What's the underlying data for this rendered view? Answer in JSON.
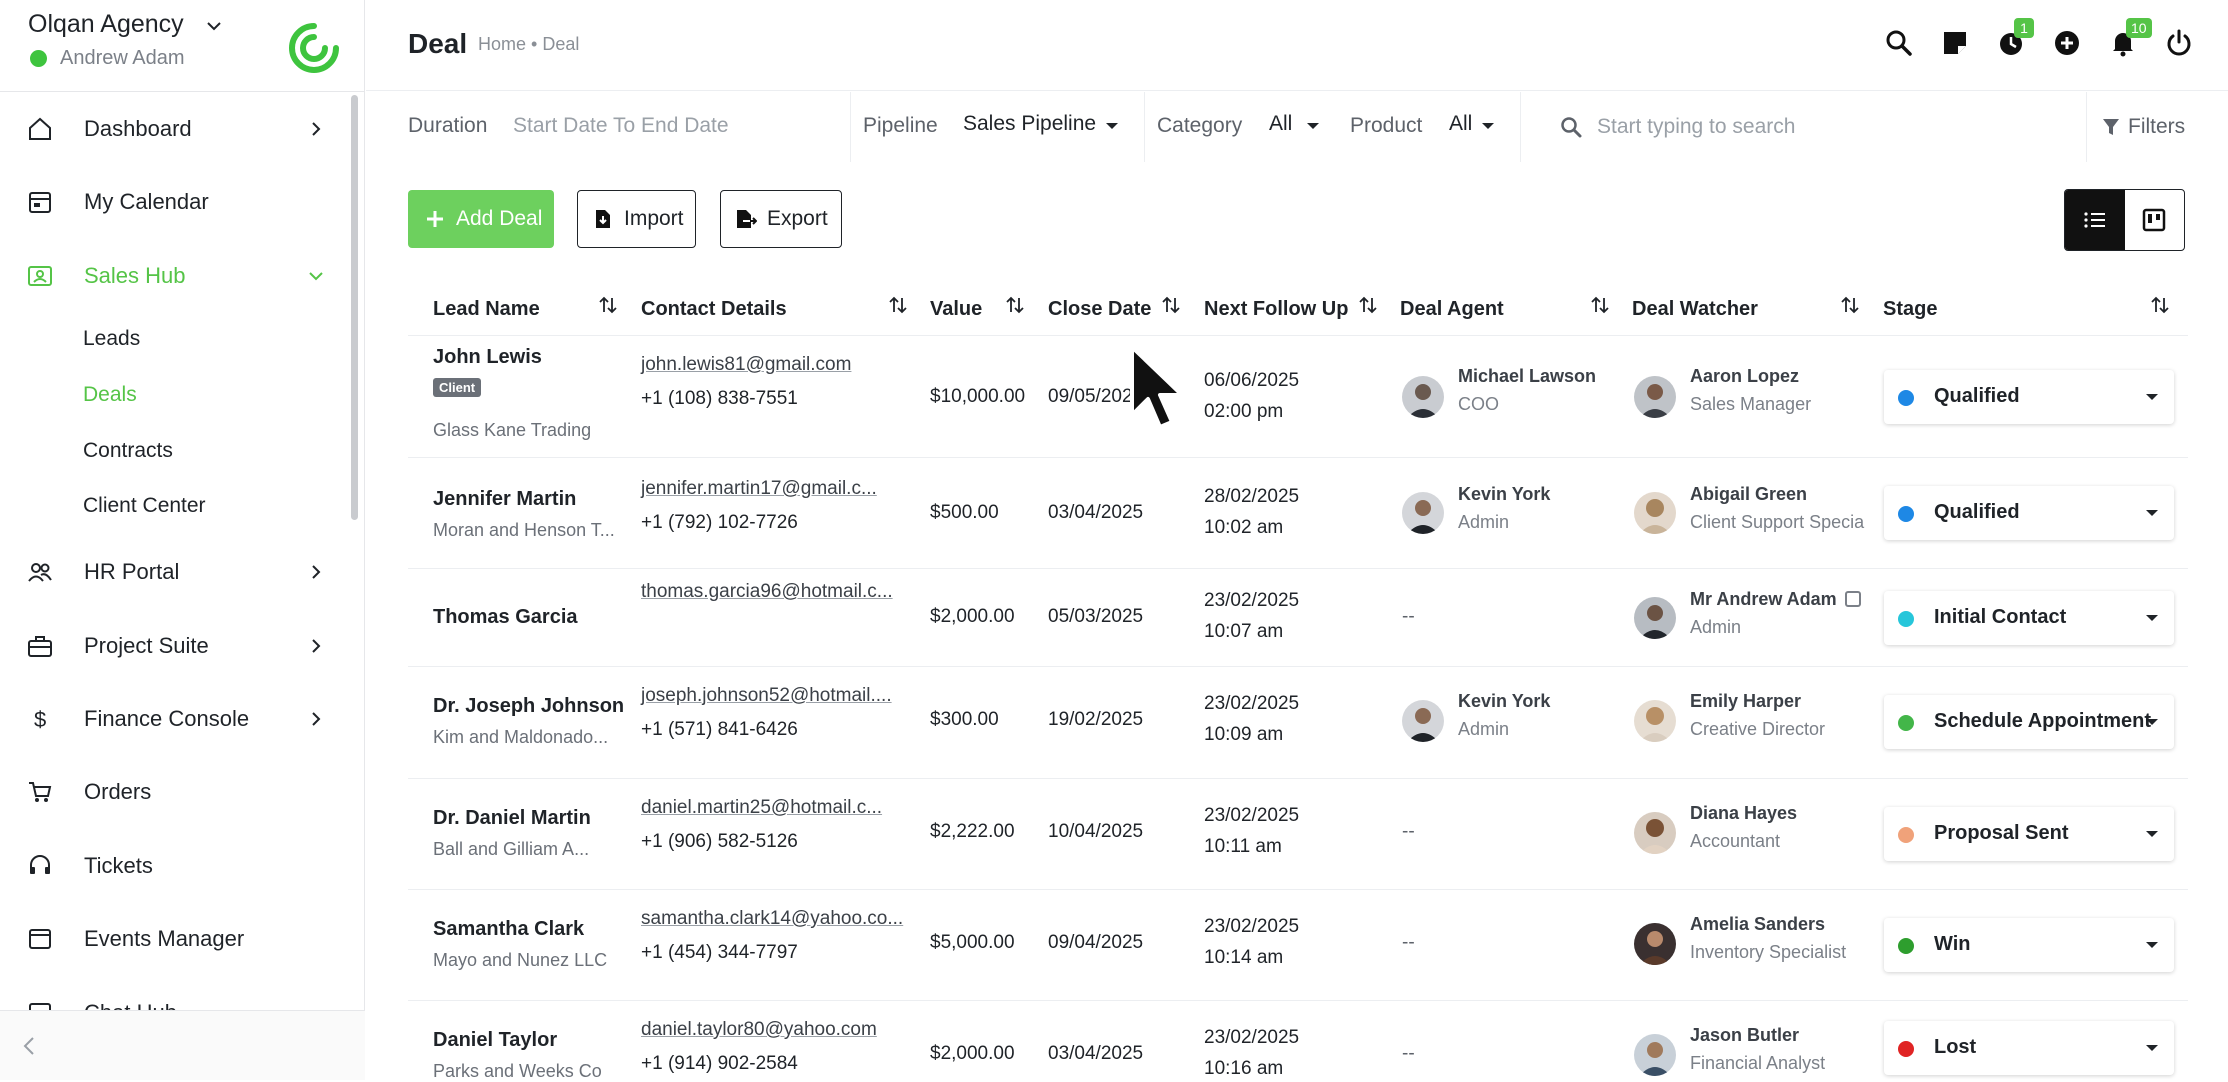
{
  "brand": {
    "name": "Olqan Agency",
    "user": "Andrew Adam"
  },
  "nav": {
    "items": [
      {
        "key": "dashboard",
        "label": "Dashboard"
      },
      {
        "key": "calendar",
        "label": "My Calendar"
      },
      {
        "key": "sales",
        "label": "Sales Hub"
      },
      {
        "key": "hr",
        "label": "HR Portal"
      },
      {
        "key": "project",
        "label": "Project Suite"
      },
      {
        "key": "finance",
        "label": "Finance Console"
      },
      {
        "key": "orders",
        "label": "Orders"
      },
      {
        "key": "tickets",
        "label": "Tickets"
      },
      {
        "key": "events",
        "label": "Events Manager"
      },
      {
        "key": "chat",
        "label": "Chat Hub"
      }
    ],
    "sub": [
      "Leads",
      "Deals",
      "Contracts",
      "Client Center"
    ]
  },
  "header": {
    "title": "Deal",
    "breadcrumb": "Home • Deal",
    "badges": {
      "timer": "1",
      "notifications": "10"
    }
  },
  "filters": {
    "duration_label": "Duration",
    "duration_value": "Start Date To End Date",
    "pipeline_label": "Pipeline",
    "pipeline_value": "Sales Pipeline",
    "category_label": "Category",
    "category_value": "All",
    "product_label": "Product",
    "product_value": "All",
    "search_placeholder": "Start typing to search",
    "filters_label": "Filters"
  },
  "actions": {
    "add": "Add Deal",
    "import": "Import",
    "export": "Export"
  },
  "table": {
    "columns": [
      "Lead Name",
      "Contact Details",
      "Value",
      "Close Date",
      "Next Follow Up",
      "Deal Agent",
      "Deal Watcher",
      "Stage"
    ],
    "rows": [
      {
        "name": "John Lewis",
        "tag": "Client",
        "company": "Glass Kane Trading",
        "email": "john.lewis81@gmail.com",
        "phone": "+1 (108) 838-7551",
        "value": "$10,000.00",
        "close": "09/05/2025",
        "follow_date": "06/06/2025",
        "follow_time": "02:00 pm",
        "agent_name": "Michael Lawson",
        "agent_role": "COO",
        "watcher_name": "Aaron Lopez",
        "watcher_role": "Sales Manager",
        "stage": "Qualified",
        "stage_color": "#1e88e5"
      },
      {
        "name": "Jennifer Martin",
        "tag": "",
        "company": "Moran and Henson T...",
        "email": "jennifer.martin17@gmail.c...",
        "phone": "+1 (792) 102-7726",
        "value": "$500.00",
        "close": "03/04/2025",
        "follow_date": "28/02/2025",
        "follow_time": "10:02 am",
        "agent_name": "Kevin York",
        "agent_role": "Admin",
        "watcher_name": "Abigail Green",
        "watcher_role": "Client Support Specia",
        "stage": "Qualified",
        "stage_color": "#1e88e5"
      },
      {
        "name": "Thomas Garcia",
        "tag": "",
        "company": "",
        "email": "thomas.garcia96@hotmail.c...",
        "phone": "",
        "value": "$2,000.00",
        "close": "05/03/2025",
        "follow_date": "23/02/2025",
        "follow_time": "10:07 am",
        "agent_name": "--",
        "agent_role": "",
        "watcher_name": "Mr Andrew Adam",
        "watcher_role": "Admin",
        "stage": "Initial Contact",
        "stage_color": "#26c6da"
      },
      {
        "name": "Dr. Joseph Johnson",
        "tag": "",
        "company": "Kim and Maldonado...",
        "email": "joseph.johnson52@hotmail....",
        "phone": "+1 (571) 841-6426",
        "value": "$300.00",
        "close": "19/02/2025",
        "follow_date": "23/02/2025",
        "follow_time": "10:09 am",
        "agent_name": "Kevin York",
        "agent_role": "Admin",
        "watcher_name": "Emily Harper",
        "watcher_role": "Creative Director",
        "stage": "Schedule Appointment",
        "stage_color": "#43b649"
      },
      {
        "name": "Dr. Daniel Martin",
        "tag": "",
        "company": "Ball and Gilliam A...",
        "email": "daniel.martin25@hotmail.c...",
        "phone": "+1 (906) 582-5126",
        "value": "$2,222.00",
        "close": "10/04/2025",
        "follow_date": "23/02/2025",
        "follow_time": "10:11 am",
        "agent_name": "--",
        "agent_role": "",
        "watcher_name": "Diana Hayes",
        "watcher_role": "Accountant",
        "stage": "Proposal Sent",
        "stage_color": "#f0a27a"
      },
      {
        "name": "Samantha Clark",
        "tag": "",
        "company": "Mayo and Nunez LLC",
        "email": "samantha.clark14@yahoo.co...",
        "phone": "+1 (454) 344-7797",
        "value": "$5,000.00",
        "close": "09/04/2025",
        "follow_date": "23/02/2025",
        "follow_time": "10:14 am",
        "agent_name": "--",
        "agent_role": "",
        "watcher_name": "Amelia Sanders",
        "watcher_role": "Inventory Specialist",
        "stage": "Win",
        "stage_color": "#2e9e2e"
      },
      {
        "name": "Daniel Taylor",
        "tag": "",
        "company": "Parks and Weeks Co",
        "email": "daniel.taylor80@yahoo.com",
        "phone": "+1 (914) 902-2584",
        "value": "$2,000.00",
        "close": "03/04/2025",
        "follow_date": "23/02/2025",
        "follow_time": "10:16 am",
        "agent_name": "--",
        "agent_role": "",
        "watcher_name": "Jason Butler",
        "watcher_role": "Financial Analyst",
        "stage": "Lost",
        "stage_color": "#e02424"
      }
    ]
  },
  "theme": {
    "accent": "#55c447",
    "button_green": "#6dd05e"
  }
}
